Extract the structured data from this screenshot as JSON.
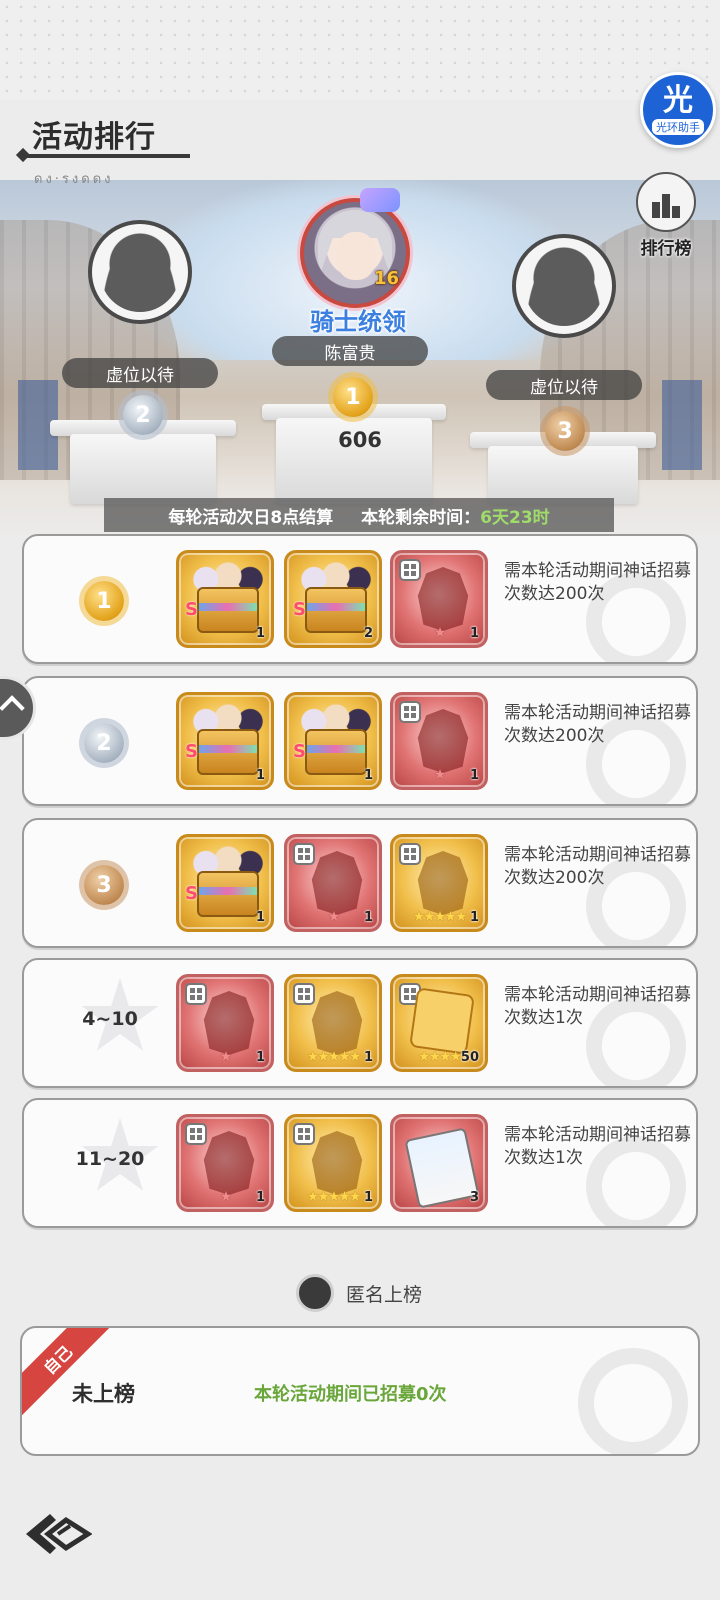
{
  "header": {
    "title": "活动排行",
    "subtitle": "ดง·รงดดง",
    "helper": {
      "big": "光",
      "small": "光环助手",
      "color": "#1e63d6"
    },
    "rank_button_label": "排行榜"
  },
  "podium": {
    "first": {
      "title": "骑士统领",
      "name": "陈富贵",
      "score": "606",
      "level": "16",
      "medal": "1"
    },
    "second": {
      "name": "虚位以待",
      "medal": "2"
    },
    "third": {
      "name": "虚位以待",
      "medal": "3"
    }
  },
  "info": {
    "settle": "每轮活动次日8点结算",
    "remain_label": "本轮剩余时间：",
    "remain_time": "6天23时"
  },
  "rewards": [
    {
      "rank": "1",
      "items": [
        {
          "type": "chest",
          "count": "1"
        },
        {
          "type": "chest",
          "count": "2"
        },
        {
          "type": "red-shard",
          "count": "1"
        }
      ],
      "desc": "需本轮活动期间神话招募次数达200次"
    },
    {
      "rank": "2",
      "items": [
        {
          "type": "chest",
          "count": "1"
        },
        {
          "type": "chest",
          "count": "1"
        },
        {
          "type": "red-shard",
          "count": "1"
        }
      ],
      "desc": "需本轮活动期间神话招募次数达200次"
    },
    {
      "rank": "3",
      "items": [
        {
          "type": "chest",
          "count": "1"
        },
        {
          "type": "red-shard",
          "count": "1"
        },
        {
          "type": "gold-shard",
          "count": "1"
        }
      ],
      "desc": "需本轮活动期间神话招募次数达200次"
    },
    {
      "rank": "4~10",
      "items": [
        {
          "type": "red-shard",
          "count": "1"
        },
        {
          "type": "gold-shard",
          "count": "1"
        },
        {
          "type": "puzzle",
          "count": "50"
        }
      ],
      "desc": "需本轮活动期间神话招募次数达1次"
    },
    {
      "rank": "11~20",
      "items": [
        {
          "type": "red-shard",
          "count": "1"
        },
        {
          "type": "gold-shard",
          "count": "1"
        },
        {
          "type": "ticket",
          "count": "3"
        }
      ],
      "desc": "需本轮活动期间神话招募次数达1次"
    }
  ],
  "anonymous_label": "匿名上榜",
  "self": {
    "tag": "自己",
    "status": "未上榜",
    "count_text": "本轮活动期间已招募0次"
  },
  "colors": {
    "accent_green": "#9fdc6a",
    "title_blue": "#3b7fe0",
    "self_tag": "#d6453f"
  }
}
